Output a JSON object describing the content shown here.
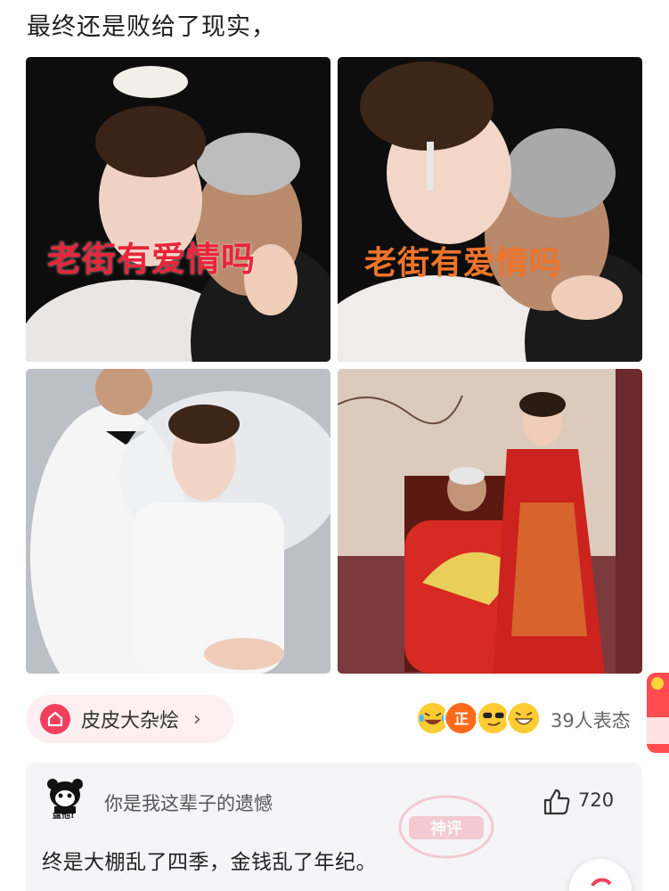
{
  "post": {
    "title": "最终还是败给了现实，",
    "photos": [
      {
        "watermark": "老街有爱情吗"
      },
      {
        "watermark": "老街有爱情吗"
      },
      {
        "watermark": ""
      },
      {
        "watermark": ""
      }
    ]
  },
  "topic": {
    "label": "皮皮大杂烩",
    "chevron": "›",
    "icon": "home-icon"
  },
  "reactions": {
    "count_text": "39人表态",
    "emoji_icons": [
      "laughing-tears-icon",
      "zheng-badge-icon",
      "sunglasses-icon",
      "grin-icon"
    ]
  },
  "comment": {
    "avatar_caption": "盘他!",
    "username": "你是我这辈子的遗憾",
    "likes": "720",
    "text": "终是大棚乱了四季，金钱乱了年纪。",
    "stamp": "神评"
  },
  "colors": {
    "accent": "#f23f5e",
    "chip_bg": "#fdeff1",
    "card_bg": "#f5f5f7"
  }
}
